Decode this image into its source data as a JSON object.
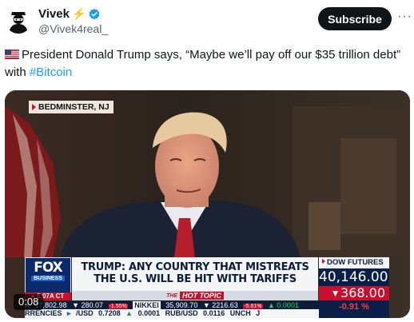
{
  "author": {
    "display_name": "Vivek",
    "handle": "@Vivek4real_",
    "bolt_icon": "lightning-emoji",
    "verified_color": "#1d9bf0"
  },
  "header": {
    "subscribe_label": "Subscribe",
    "more_label": "···"
  },
  "tweet": {
    "text": "President Donald Trump says,  “Maybe we’ll pay off our $35 trillion debt” with ",
    "hashtag": "#Bitcoin",
    "hashtag_color": "#1d9bf0",
    "flag_icon": "us-flag-emoji"
  },
  "video": {
    "location_tag": "BEDMINSTER, NJ",
    "timestamp": "0:08",
    "channel": {
      "logo_word": "FOX",
      "logo_sub": "BUSINESS",
      "time": "▸ 6:07A CT"
    },
    "headline_line1": "TRUMP: ANY COUNTRY THAT MISTREATS",
    "headline_line2": "THE U.S. WILL BE HIT WITH TARIFFS",
    "hot_the": "THE",
    "hot_topic": "HOT TOPIC",
    "dow": {
      "label": "DOW FUTURES",
      "value": "40,146.00",
      "change": "368.00",
      "change_arrow": "▼",
      "percent": "-0.91 %"
    },
    "ticker_row1": {
      "a": "X",
      "b": "17,802.98",
      "c": "▼ 280.07",
      "d": "-1.55%",
      "e": "NIKKEI",
      "f": "35,909.70",
      "g": "▼ 2216.63",
      "h": "-5.81%",
      "i": "▲ 0.0001"
    },
    "ticker_row2": {
      "a": "RRENCIES",
      "b": "▸",
      "c": "/USD",
      "d": "0.7208",
      "e": "▲",
      "f": "0.0001",
      "g": "RUB/USD",
      "h": "0.0116",
      "i": "UNCH",
      "j": "J"
    }
  }
}
